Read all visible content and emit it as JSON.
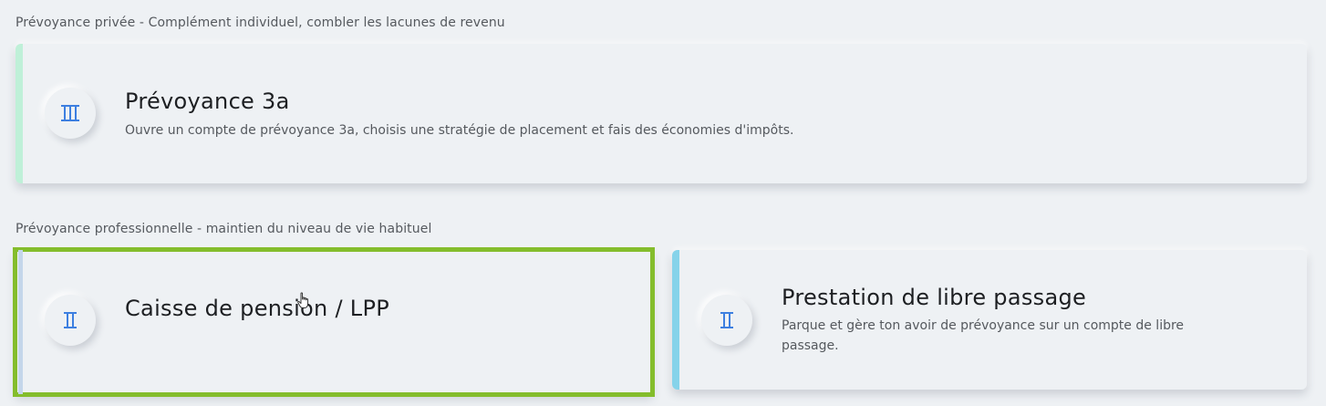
{
  "sections": [
    {
      "title": "Prévoyance privée - Complément individuel, combler les lacunes de revenu",
      "cards": [
        {
          "title": "Prévoyance 3a",
          "description": "Ouvre un compte de prévoyance 3a, choisis une stratégie de placement et fais des économies d'impôts.",
          "icon": "pillar-3-icon",
          "accent_color": "#bff0d8"
        }
      ]
    },
    {
      "title": "Prévoyance professionnelle - maintien du niveau de vie habituel",
      "cards": [
        {
          "title": "Caisse de pension / LPP",
          "description": "",
          "icon": "pillar-2-icon",
          "accent_color": "#c4d6ea",
          "selected": true
        },
        {
          "title": "Prestation de libre passage",
          "description": "Parque et gère ton avoir de prévoyance sur un compte de libre passage.",
          "icon": "pillar-2-icon",
          "accent_color": "#86d3ea"
        }
      ]
    }
  ],
  "colors": {
    "icon_blue": "#3d7fe0",
    "selection_green": "#84bd2c",
    "background": "#eef1f4"
  }
}
